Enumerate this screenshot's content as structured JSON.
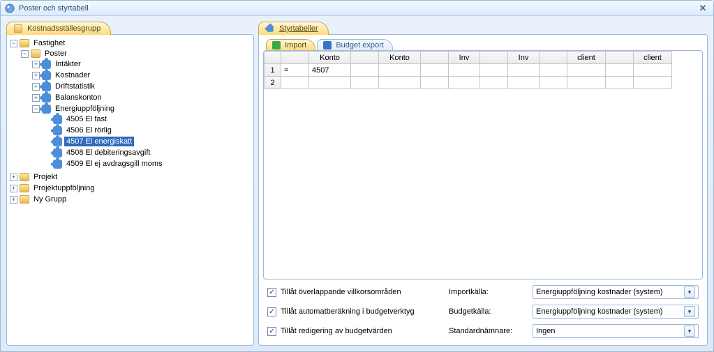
{
  "window": {
    "title": "Poster och styrtabell"
  },
  "left_tab": {
    "label": "Kostnadsställesgrupp"
  },
  "tree": {
    "n0": {
      "label": "Fastighet",
      "exp": "−"
    },
    "n1": {
      "label": "Poster",
      "exp": "−"
    },
    "n2": {
      "label": "Intäkter",
      "exp": "+"
    },
    "n3": {
      "label": "Kostnader",
      "exp": "+"
    },
    "n4": {
      "label": "Driftstatistik",
      "exp": "+"
    },
    "n5": {
      "label": "Balanskonton",
      "exp": "+"
    },
    "n6": {
      "label": "Energiuppföljning",
      "exp": "−"
    },
    "n7": {
      "label": "4505 El fast"
    },
    "n8": {
      "label": "4506 El rörlig"
    },
    "n9": {
      "label": "4507 El energiskatt"
    },
    "n10": {
      "label": "4508 El debiteringsavgift"
    },
    "n11": {
      "label": "4509 El ej avdragsgill moms"
    },
    "n12": {
      "label": "Projekt",
      "exp": "+"
    },
    "n13": {
      "label": "Projektuppföljning",
      "exp": "+"
    },
    "n14": {
      "label": "Ny Grupp",
      "exp": "+"
    }
  },
  "right_tab": {
    "label": "Styrtabeller"
  },
  "subtabs": {
    "import": "Import",
    "budget": "Budget export"
  },
  "grid": {
    "headers": {
      "c0": "",
      "c1": "Konto",
      "c2": "",
      "c3": "Konto",
      "c4": "",
      "c5": "Inv",
      "c6": "",
      "c7": "Inv",
      "c8": "",
      "c9": "client",
      "c10": "",
      "c11": "client"
    },
    "rows": [
      {
        "num": "1",
        "c0": "=",
        "c1": "4507",
        "c2": "",
        "c3": "",
        "c4": "",
        "c5": "",
        "c6": "",
        "c7": "",
        "c8": "",
        "c9": "",
        "c10": "",
        "c11": ""
      },
      {
        "num": "2",
        "c0": "",
        "c1": "",
        "c2": "",
        "c3": "",
        "c4": "",
        "c5": "",
        "c6": "",
        "c7": "",
        "c8": "",
        "c9": "",
        "c10": "",
        "c11": ""
      }
    ]
  },
  "form": {
    "chk1": "Tillåt överlappande villkorsområden",
    "chk2": "Tillåt automatberäkning i budgetverktyg",
    "chk3": "Tillåt redigering av budgetvärden",
    "lbl1": "Importkälla:",
    "lbl2": "Budgetkälla:",
    "lbl3": "Standardnämnare:",
    "sel1": "Energiuppföljning kostnader (system)",
    "sel2": "Energiuppföljning kostnader (system)",
    "sel3": "Ingen"
  }
}
